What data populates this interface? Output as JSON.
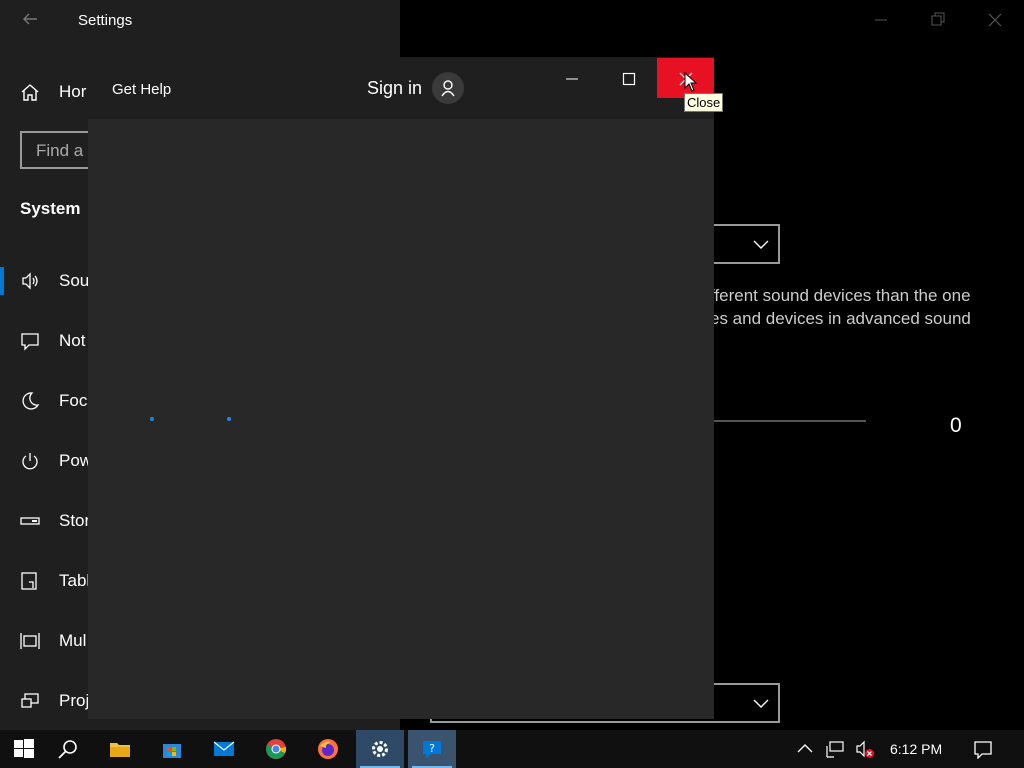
{
  "settings": {
    "title": "Settings",
    "search_placeholder": "Find a",
    "section": "System",
    "nav": [
      {
        "label": "Hor",
        "icon": "home-icon"
      },
      {
        "label": "Sou",
        "icon": "speaker-icon",
        "selected": true
      },
      {
        "label": "Not",
        "icon": "notification-icon"
      },
      {
        "label": "Focu",
        "icon": "moon-icon"
      },
      {
        "label": "Pow",
        "icon": "power-icon"
      },
      {
        "label": "Stor",
        "icon": "storage-icon"
      },
      {
        "label": "Tabl",
        "icon": "tablet-icon"
      },
      {
        "label": "Mul",
        "icon": "multitasking-icon"
      },
      {
        "label": "Proj",
        "icon": "project-icon"
      }
    ],
    "main": {
      "description_line1": "fferent sound devices than the one",
      "description_line2": "es and devices in advanced sound",
      "volume_value": "0"
    }
  },
  "gethelp": {
    "title": "Get Help",
    "sign_in": "Sign in",
    "tooltip": "Close"
  },
  "taskbar": {
    "time": "6:12 PM",
    "apps": [
      "start-icon",
      "search-icon",
      "file-explorer-icon",
      "store-icon",
      "mail-icon",
      "chrome-icon",
      "firefox-icon",
      "settings-icon",
      "get-help-icon"
    ]
  },
  "colors": {
    "accent": "#0078d7",
    "close_red": "#e81123",
    "sidebar_bg": "#1f1f1f",
    "gethelp_bg": "#282828"
  }
}
